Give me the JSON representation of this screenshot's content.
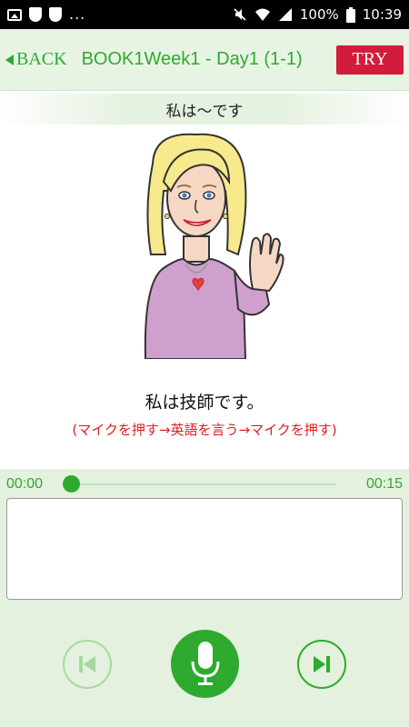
{
  "status_bar": {
    "dots": "...",
    "battery": "100%",
    "time": "10:39"
  },
  "header": {
    "back_label": "BACK",
    "title": "BOOK1Week1 - Day1 (1-1)",
    "try_label": "TRY"
  },
  "lesson": {
    "subtitle": "私は〜です",
    "sentence": "私は技師です。",
    "instruction": "(マイクを押す→英語を言う→マイクを押す)"
  },
  "player": {
    "current_time": "00:00",
    "total_time": "00:15",
    "progress": 0
  },
  "answer_box": {
    "value": ""
  },
  "colors": {
    "accent_green": "#2eaa2e",
    "header_bg": "#e8f4e3",
    "try_red": "#d11c3b",
    "instruction_red": "#e0201e"
  },
  "icons": {
    "prev": "skip-previous-icon",
    "mic": "microphone-icon",
    "next": "skip-next-icon"
  }
}
